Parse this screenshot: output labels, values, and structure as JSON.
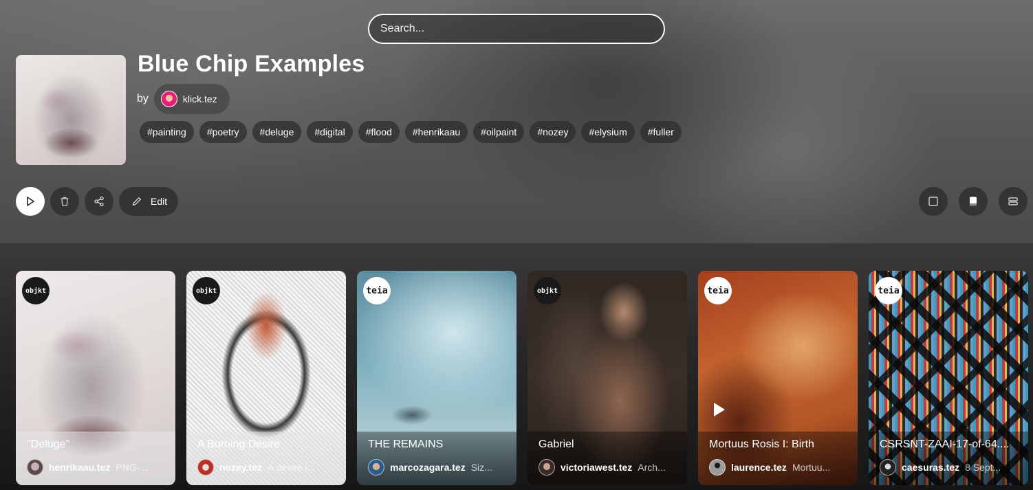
{
  "search": {
    "placeholder": "Search..."
  },
  "collection": {
    "title": "Blue Chip Examples",
    "by_label": "by",
    "creator": "klick.tez",
    "tags": [
      "#painting",
      "#poetry",
      "#deluge",
      "#digital",
      "#flood",
      "#henrikaau",
      "#oilpaint",
      "#nozey",
      "#elysium",
      "#fuller"
    ]
  },
  "actions": {
    "edit_label": "Edit",
    "icons": [
      "play-icon",
      "trash-icon",
      "share-icon",
      "pencil-icon"
    ]
  },
  "view_modes": [
    "single-view-icon",
    "card-view-icon",
    "list-view-icon"
  ],
  "cards": [
    {
      "title": "\"Deluge\"",
      "creator": "henrikaau.tez",
      "description": "PNG-...",
      "badge": "objkt"
    },
    {
      "title": "A Burning Desire",
      "creator": "nozey.tez",
      "description": "A desire i...",
      "badge": "objkt"
    },
    {
      "title": "THE REMAINS",
      "creator": "marcozagara.tez",
      "description": "Siz...",
      "badge": "teia"
    },
    {
      "title": "Gabriel",
      "creator": "victoriawest.tez",
      "description": "Arch...",
      "badge": "objkt"
    },
    {
      "title": "Mortuus Rosis I: Birth",
      "creator": "laurence.tez",
      "description": "Mortuu...",
      "badge": "teia"
    },
    {
      "title": "CSRSNT-ZAAI-17-of-64....",
      "creator": "caesuras.tez",
      "description": "8 Sept...",
      "badge": "teia"
    }
  ],
  "colors": {
    "accent": "#ffffff",
    "chip_bg": "#2d2d2d",
    "avatar_pink": "#e81f78"
  }
}
